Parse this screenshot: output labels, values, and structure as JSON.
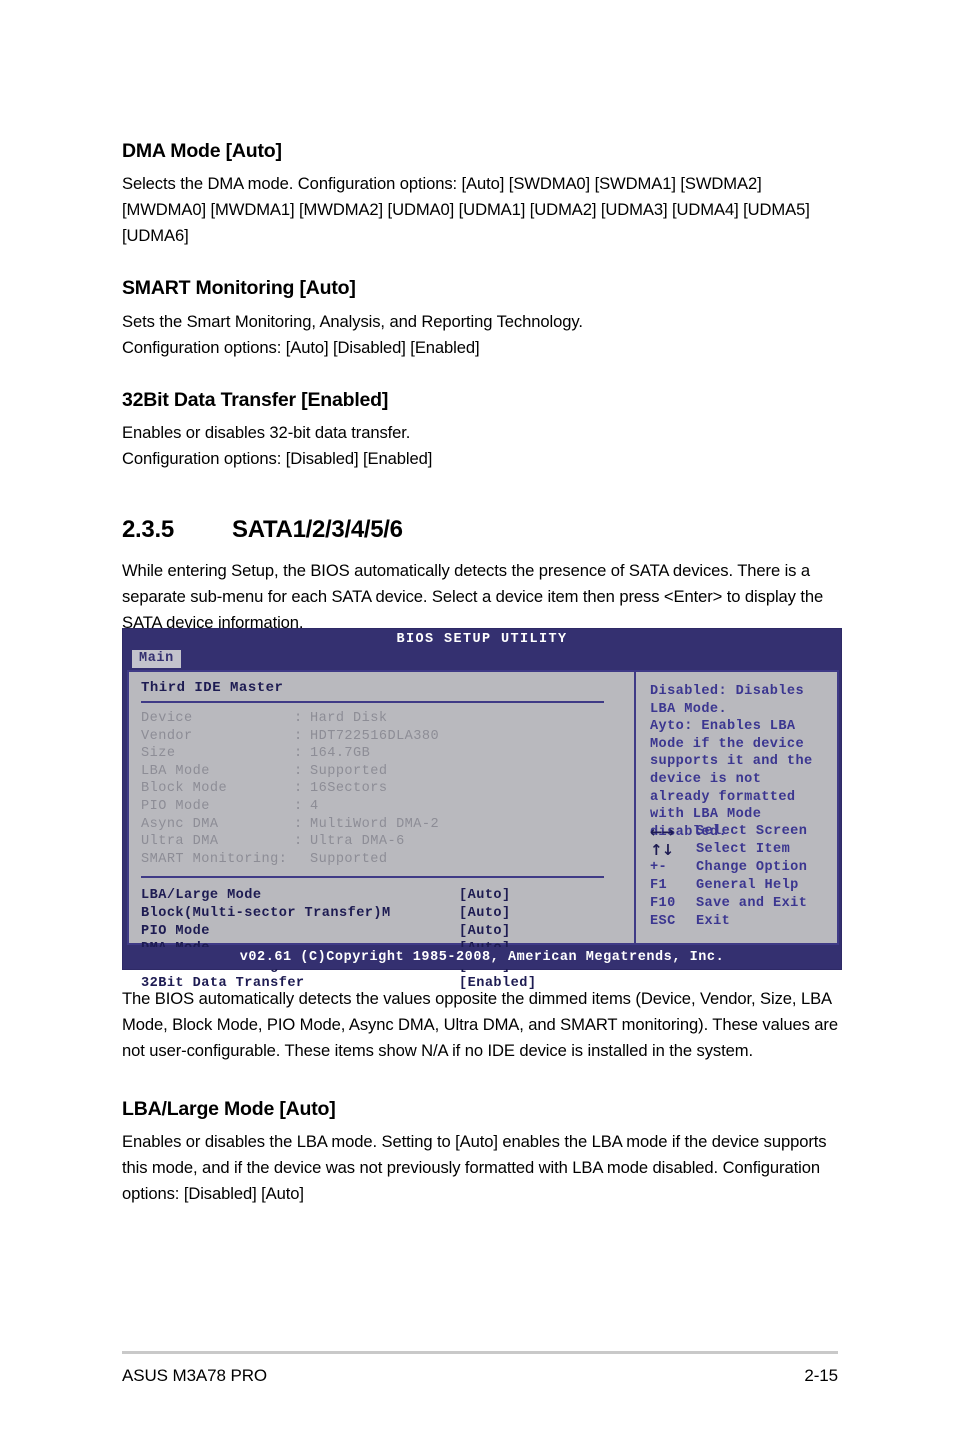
{
  "document": {
    "footer_left": "ASUS M3A78 PRO",
    "page_number": "2-15"
  },
  "sections": {
    "dma_mode": {
      "heading": "DMA Mode [Auto]",
      "body": "Selects the DMA mode. Configuration options: [Auto] [SWDMA0] [SWDMA1] [SWDMA2] [MWDMA0] [MWDMA1] [MWDMA2] [UDMA0] [UDMA1] [UDMA2] [UDMA3] [UDMA4] [UDMA5] [UDMA6]"
    },
    "smart_monitoring": {
      "heading": "SMART Monitoring [Auto]",
      "body_line1": "Sets the Smart Monitoring, Analysis, and Reporting Technology.",
      "body_line2": "Configuration options: [Auto] [Disabled] [Enabled]"
    },
    "data_transfer_32bit": {
      "heading": "32Bit Data Transfer [Enabled]",
      "body_line1": "Enables or disables 32-bit data transfer.",
      "body_line2": "Configuration options: [Disabled] [Enabled]"
    },
    "sata_section": {
      "number": "2.3.5",
      "title": "SATA1/2/3/4/5/6",
      "intro": "While entering Setup, the BIOS automatically detects the presence of SATA devices. There is a separate sub-menu for each SATA device. Select a device item then press <Enter> to display the SATA device information.",
      "after_figure": "The BIOS automatically detects the values opposite the dimmed items (Device, Vendor, Size, LBA Mode, Block Mode, PIO Mode, Async DMA, Ultra DMA, and SMART monitoring). These values are not user-configurable. These items show N/A if no IDE device is installed in the system."
    },
    "lba_large_mode": {
      "heading": "LBA/Large Mode [Auto]",
      "body": "Enables or disables the LBA mode. Setting to [Auto] enables the LBA mode if the device supports this mode, and if the device was not previously formatted with LBA mode disabled. Configuration options: [Disabled] [Auto]"
    }
  },
  "bios_screen": {
    "title": "BIOS SETUP UTILITY",
    "active_tab": "Main",
    "panel_heading": "Third IDE Master",
    "device_info": [
      {
        "label": "Device",
        "colon": ":",
        "value": "Hard Disk"
      },
      {
        "label": "Vendor",
        "colon": ":",
        "value": "HDT722516DLA380"
      },
      {
        "label": "Size",
        "colon": ":",
        "value": "164.7GB"
      },
      {
        "label": "LBA Mode",
        "colon": ":",
        "value": "Supported"
      },
      {
        "label": "Block Mode",
        "colon": ":",
        "value": "16Sectors"
      },
      {
        "label": "PIO Mode",
        "colon": ":",
        "value": "4"
      },
      {
        "label": "Async DMA",
        "colon": ":",
        "value": "MultiWord DMA-2"
      },
      {
        "label": "Ultra DMA",
        "colon": ":",
        "value": "Ultra DMA-6"
      }
    ],
    "smart_line": {
      "label": "SMART Monitoring:",
      "value": "Supported"
    },
    "options": [
      {
        "label": "LBA/Large Mode",
        "value": "[Auto]"
      },
      {
        "label": "Block(Multi-sector Transfer)M",
        "value": "[Auto]"
      },
      {
        "label": "PIO Mode",
        "value": "[Auto]"
      },
      {
        "label": "DMA Mode",
        "value": "[Auto]"
      },
      {
        "label": "SMART Monitoring",
        "value": "[Auto]"
      },
      {
        "label": "32Bit Data Transfer",
        "value": "[Enabled]"
      }
    ],
    "help_text": "Disabled: Disables LBA Mode.\nAyto: Enables LBA Mode if the device supports it and the device is not already formatted with LBA Mode disabled.",
    "legend": [
      {
        "key": "←→",
        "glyph": true,
        "action": "Select Screen"
      },
      {
        "key": "↑↓",
        "glyph": true,
        "action": "Select Item"
      },
      {
        "key": "+-",
        "glyph": false,
        "action": "Change Option"
      },
      {
        "key": "F1",
        "glyph": false,
        "action": "General Help"
      },
      {
        "key": "F10",
        "glyph": false,
        "action": "Save and Exit"
      },
      {
        "key": "ESC",
        "glyph": false,
        "action": "Exit"
      }
    ],
    "footer": "v02.61 (C)Copyright 1985-2008, American Megatrends, Inc.",
    "colors": {
      "header_navy": "#343070",
      "panel_gray": "#b9b9be",
      "border_blue": "#3f3a86",
      "dim_text": "#8d8d96",
      "active_text": "#1d1b52"
    }
  }
}
